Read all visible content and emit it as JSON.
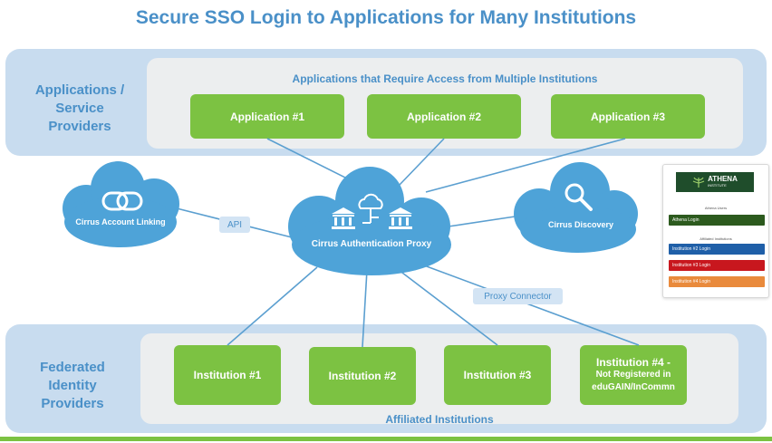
{
  "title": "Secure SSO Login to Applications for Many Institutions",
  "top_row": {
    "label_lines": [
      "Applications /",
      "Service",
      "Providers"
    ],
    "caption": "Applications that Require Access from Multiple Institutions",
    "apps": [
      "Application #1",
      "Application #2",
      "Application #3"
    ]
  },
  "middle": {
    "proxy_label": "Cirrus Authentication Proxy",
    "account_linking_label": "Cirrus Account Linking",
    "discovery_label": "Cirrus Discovery",
    "api_label": "API",
    "proxy_connector_label": "Proxy Connector"
  },
  "bottom_row": {
    "label_lines": [
      "Federated",
      "Identity",
      "Providers"
    ],
    "caption": "Affiliated Institutions",
    "institutions": [
      "Institution #1",
      "Institution #2",
      "Institution #3"
    ],
    "institution4_lines": [
      "Institution #4 -",
      "Not Registered in",
      "eduGAIN/InCommn"
    ]
  },
  "login_panel": {
    "logo_text": "ATHENA",
    "logo_sub": "INSTITUTE",
    "users_caption": "Athena Users",
    "athena_login": "Athena Login",
    "affiliated_caption": "Affiliated Institutions",
    "buttons": [
      {
        "label": "Institution #2 Login",
        "color": "#1f5fa8"
      },
      {
        "label": "Institution #3 Login",
        "color": "#c8171e"
      },
      {
        "label": "Institution #4 Login",
        "color": "#e98a3c"
      }
    ],
    "athena_color": "#2c5a1e",
    "logo_bg": "#1f4d2b"
  },
  "colors": {
    "accent": "#4a90c8",
    "band": "#c8dcef",
    "green": "#7cc242",
    "cloud": "#4ea3d8",
    "line": "#5b9fd0",
    "bottom_rule": "#7cc242"
  }
}
